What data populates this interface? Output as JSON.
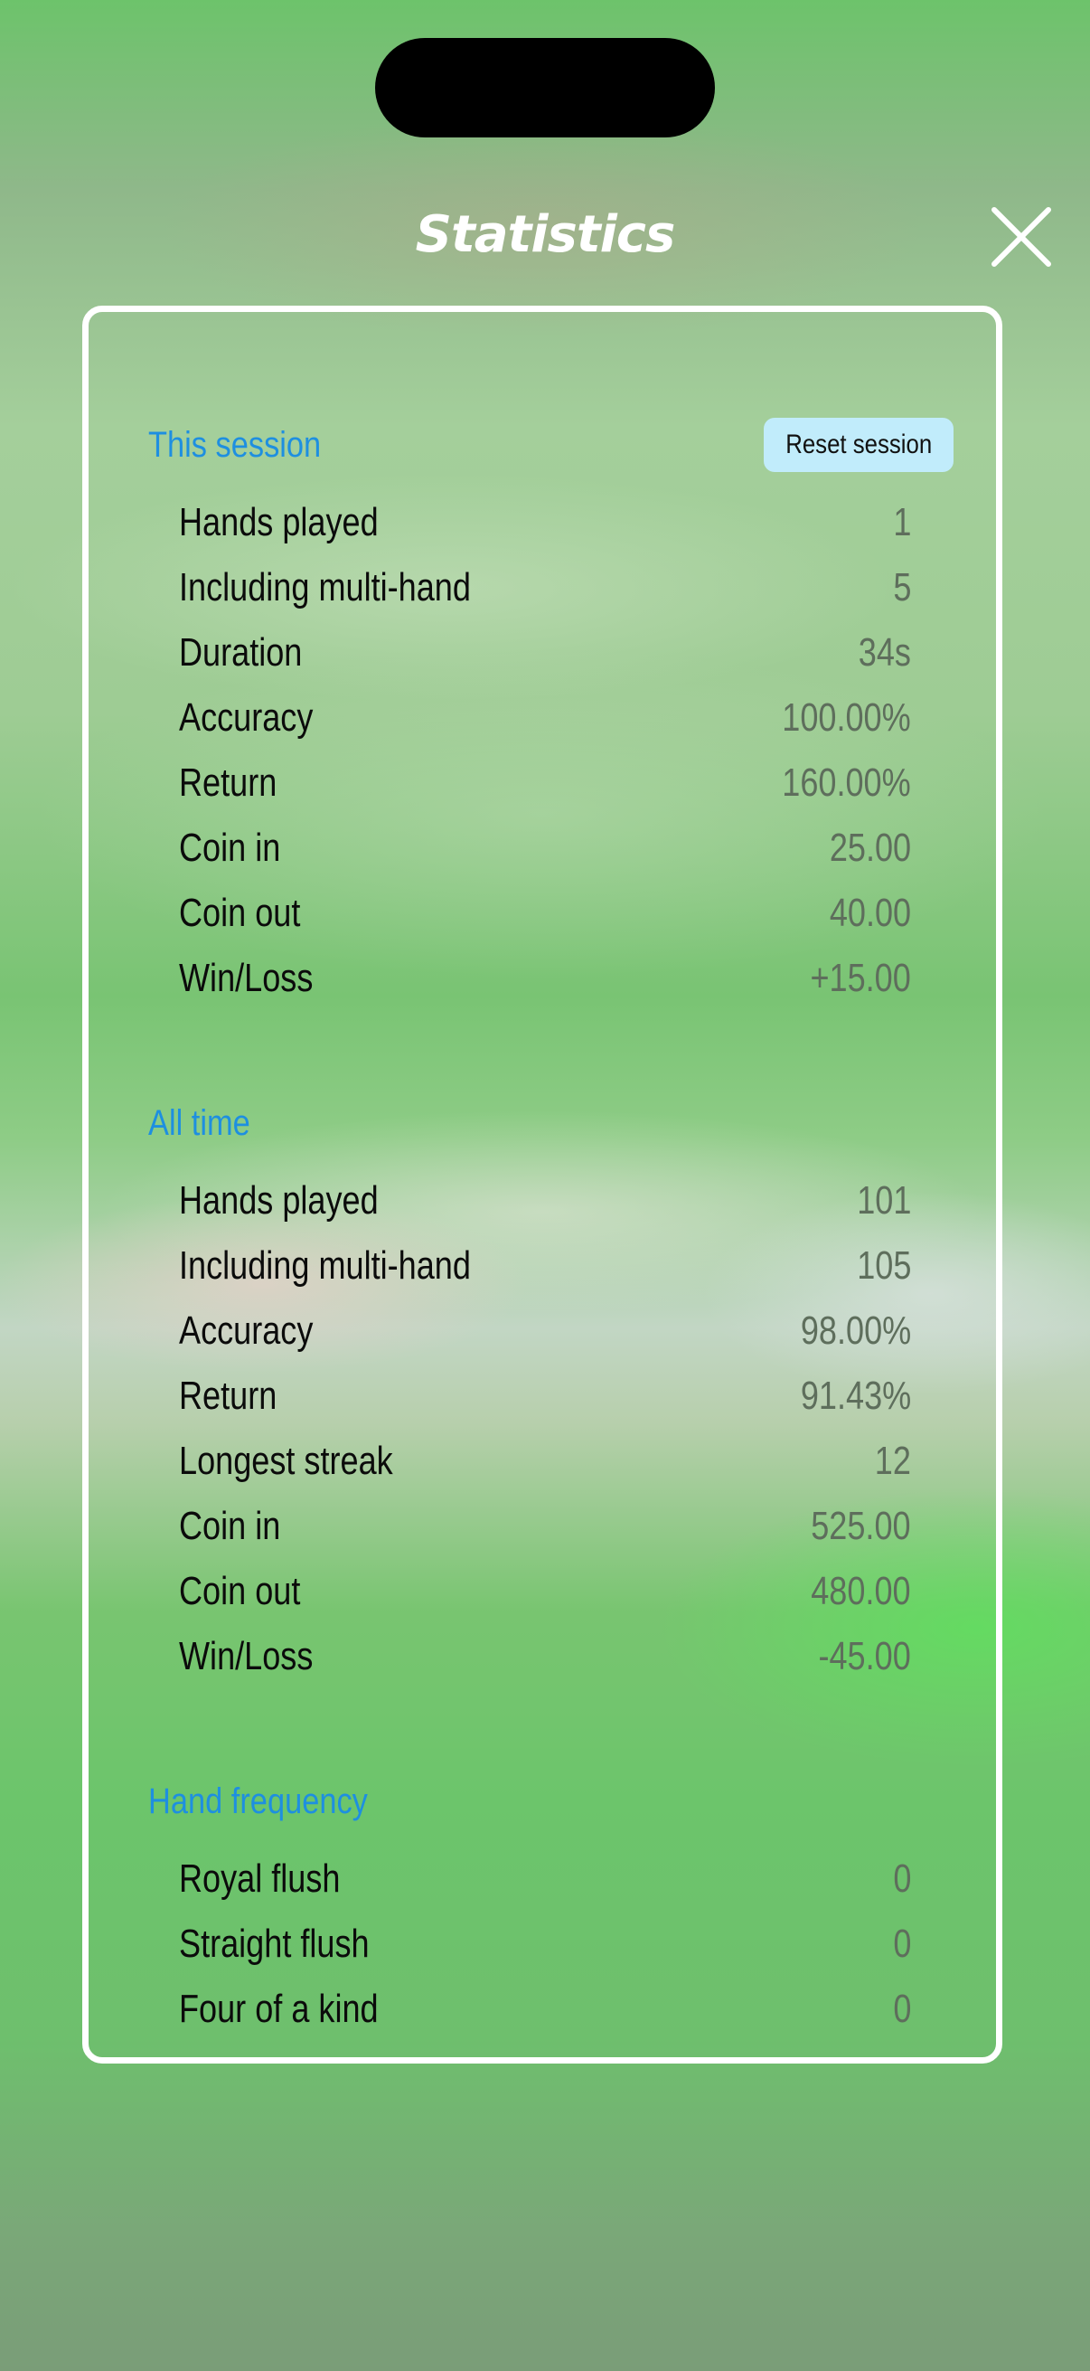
{
  "header": {
    "title": "Statistics"
  },
  "session": {
    "title": "This session",
    "reset_label": "Reset session",
    "rows": [
      {
        "label": "Hands played",
        "value": "1"
      },
      {
        "label": "Including multi-hand",
        "value": "5"
      },
      {
        "label": "Duration",
        "value": "34s"
      },
      {
        "label": "Accuracy",
        "value": "100.00%"
      },
      {
        "label": "Return",
        "value": "160.00%"
      },
      {
        "label": "Coin in",
        "value": "25.00"
      },
      {
        "label": "Coin out",
        "value": "40.00"
      },
      {
        "label": "Win/Loss",
        "value": "+15.00"
      }
    ]
  },
  "all_time": {
    "title": "All time",
    "rows": [
      {
        "label": "Hands played",
        "value": "101"
      },
      {
        "label": "Including multi-hand",
        "value": "105"
      },
      {
        "label": "Accuracy",
        "value": "98.00%"
      },
      {
        "label": "Return",
        "value": "91.43%"
      },
      {
        "label": "Longest streak",
        "value": "12"
      },
      {
        "label": "Coin in",
        "value": "525.00"
      },
      {
        "label": "Coin out",
        "value": "480.00"
      },
      {
        "label": "Win/Loss",
        "value": "-45.00"
      }
    ]
  },
  "hand_frequency": {
    "title": "Hand frequency",
    "rows": [
      {
        "label": "Royal flush",
        "value": "0"
      },
      {
        "label": "Straight flush",
        "value": "0"
      },
      {
        "label": "Four of a kind",
        "value": "0"
      }
    ]
  },
  "icons": {
    "close": "close-icon"
  },
  "colors": {
    "section_title": "#1e8fe0",
    "reset_button_bg": "#c1ecfb",
    "value_text": "#5e6e5c",
    "label_text": "#0b0b0b"
  }
}
